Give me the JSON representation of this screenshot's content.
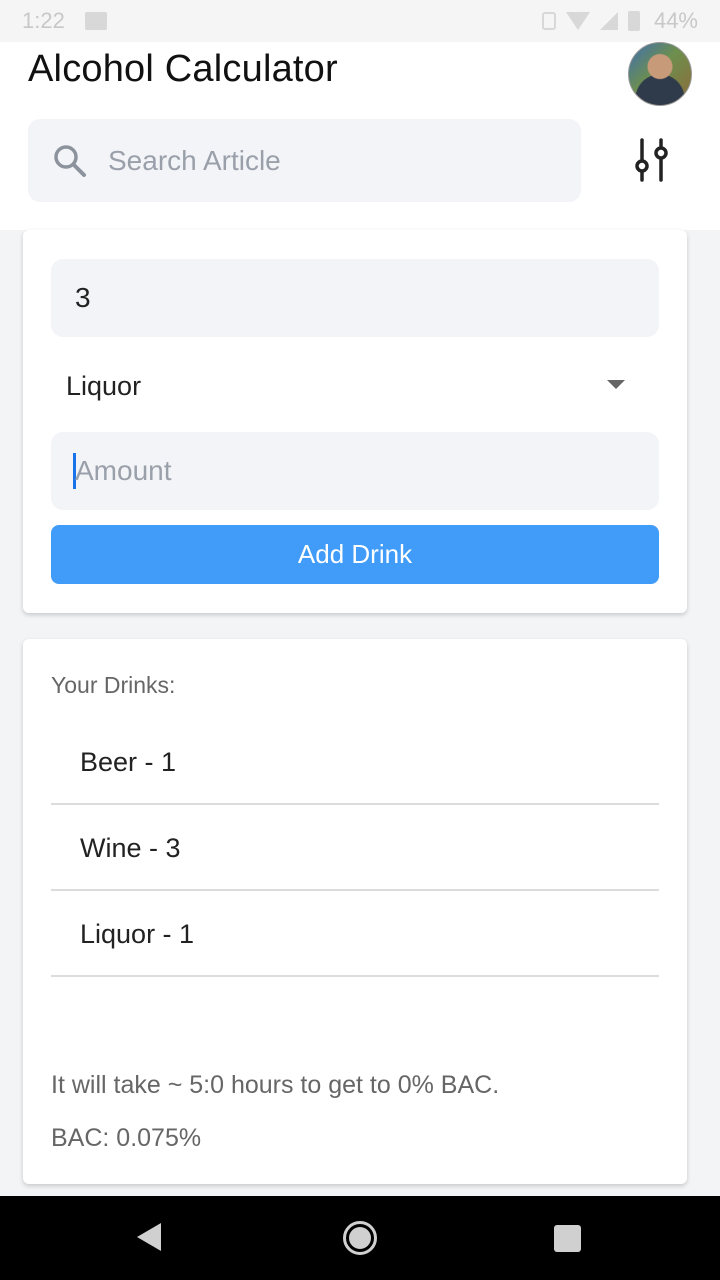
{
  "status_bar": {
    "time": "1:22",
    "battery": "44%"
  },
  "header": {
    "title": "Alcohol Calculator",
    "search": {
      "placeholder": "Search Article",
      "value": ""
    }
  },
  "form": {
    "quantity_value": "3",
    "drink_type": "Liquor",
    "amount_placeholder": "Amount",
    "amount_value": "",
    "add_button_label": "Add Drink"
  },
  "drinks": {
    "heading": "Your Drinks:",
    "items": [
      {
        "label": "Beer - 1"
      },
      {
        "label": "Wine - 3"
      },
      {
        "label": "Liquor - 1"
      }
    ],
    "time_to_zero_text": "It will take ~ 5:0 hours to get to 0% BAC.",
    "bac_text": "BAC: 0.075%"
  },
  "colors": {
    "accent": "#409cf8",
    "field_background": "#f3f4f8",
    "text_secondary": "#666666"
  },
  "icons": {
    "search": "search-icon",
    "filter": "sliders-icon",
    "nav_back": "back-triangle-icon",
    "nav_home": "home-circle-icon",
    "nav_recent": "recent-square-icon"
  }
}
